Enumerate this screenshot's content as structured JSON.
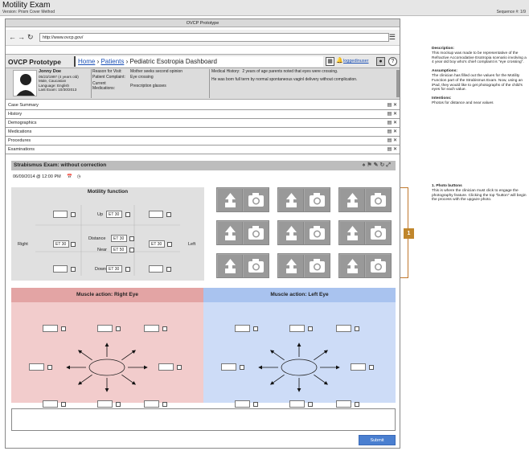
{
  "header": {
    "title": "Motility Exam",
    "version": "Version: Prism Cover Method",
    "sequence": "Sequence #:   1/9"
  },
  "window": {
    "title": "OVCP Prototype",
    "url": "http://www.ovcp.gov/"
  },
  "app": {
    "brand": "OVCP Prototype",
    "crumb_home": "Home",
    "crumb_patients": "Patients",
    "crumb_page": " Pediatric Esotropia Dashboard",
    "user": "loggedinuser"
  },
  "patient": {
    "name": "Jonny Doe",
    "dob": "05/23/1997 (4 years old)",
    "sex": "Male, Caucasian",
    "language": "Language: English",
    "last_exam": "Last Exam: 10/30/2013",
    "labels": {
      "reason": "Reason for Visit:",
      "complaint": "Patient Complaint:",
      "current": "Current",
      "meds": "Medications:",
      "history": "Medical History:"
    },
    "reason": "Mother seeks second opinion",
    "complaint": "Eye crossing",
    "medications": "Prescription glasses",
    "history1": "2 years of age parents noted that eyes were crossing.",
    "history2": "He was born full term by normal spontaneous vaginl delivery without complication."
  },
  "accordion": [
    "Case Summary",
    "History",
    "Demographics",
    "Medications",
    "Procedures",
    "Examinations"
  ],
  "exam": {
    "title": "Strabismus Exam: without correction",
    "datetime": "06/09/2014 @ 12:00 PM"
  },
  "motility": {
    "title": "Motility function",
    "labels": {
      "up": "Up",
      "right": "Right",
      "left": "Left",
      "distance": "Distance",
      "near": "Near",
      "down": "Down"
    },
    "values": {
      "up": "ET 30",
      "right": "ET 30",
      "left": "ET 30",
      "distance": "ET 30",
      "near": "ET 50",
      "down": "ET 30"
    }
  },
  "muscle": {
    "right_title": "Muscle action: Right Eye",
    "left_title": "Muscle action: Left Eye"
  },
  "submit": "Submit",
  "notes": {
    "desc_h": "Description:",
    "desc": "This mockup was made to be representative of the Refractive Accomodative Esotropia scenario involving a 4 year old boy who's chief complaint is \"eye crossing\".",
    "assump_h": "Assumptions:",
    "assump": "The clinician has filled out the values for the Motility Function part of the Strabismus Exam. Now, using an iPad, they would like to get photographs of the child's eyes for each value.",
    "intent_h": "Intentions:",
    "intent": "Photos for distance and near values",
    "ann_h": "1. Photo buttons",
    "ann": "This is where the clinician must click to engage the photography feature. Clicking the top \"button\" will begin the process with the upgaze photo.",
    "marker": "1"
  }
}
